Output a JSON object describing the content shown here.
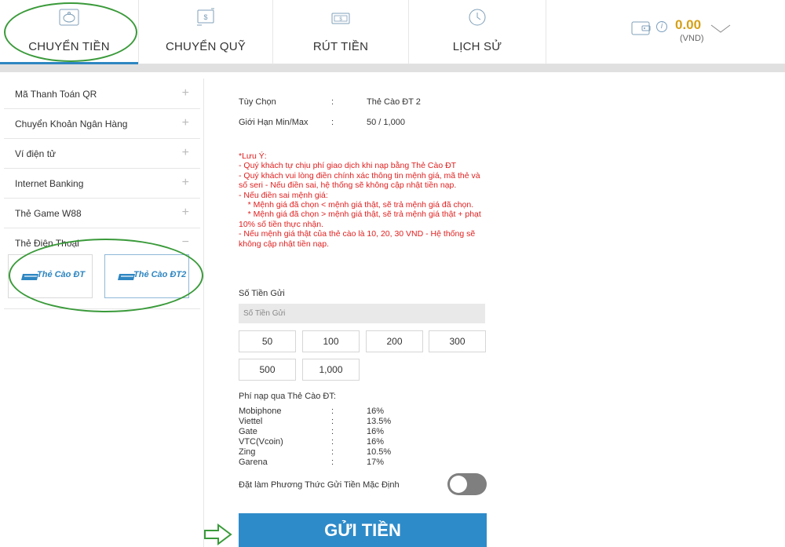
{
  "nav": {
    "tabs": [
      {
        "label": "CHUYỂN TIỀN",
        "icon": "piggy-bank-icon",
        "active": true
      },
      {
        "label": "CHUYỂN QUỸ",
        "icon": "transfer-icon",
        "active": false
      },
      {
        "label": "RÚT TIỀN",
        "icon": "cash-icon",
        "active": false
      },
      {
        "label": "LỊCH SỬ",
        "icon": "history-icon",
        "active": false
      }
    ],
    "info": "i",
    "balance": "0.00",
    "currency": "(VND)"
  },
  "sidebar": {
    "items": [
      {
        "label": "Mã Thanh Toán QR",
        "toggle": "+"
      },
      {
        "label": "Chuyển Khoản Ngân Hàng",
        "toggle": "+"
      },
      {
        "label": "Ví điện tử",
        "toggle": "+"
      },
      {
        "label": "Internet Banking",
        "toggle": "+"
      },
      {
        "label": "Thẻ Game W88",
        "toggle": "+"
      },
      {
        "label": "Thẻ Điện Thoại",
        "toggle": "−"
      }
    ],
    "cards": [
      {
        "label": "Thẻ Cào ĐT",
        "selected": false
      },
      {
        "label": "Thẻ Cào ĐT2",
        "selected": true
      }
    ]
  },
  "form": {
    "option_label": "Tùy Chọn",
    "option_sep": ":",
    "option_value": "Thẻ Cào ĐT 2",
    "limit_label": "Giới Hạn Min/Max",
    "limit_sep": ":",
    "limit_value": "50 / 1,000",
    "notice": "*Lưu Ý:\n- Quý khách tự chịu phí giao dịch khi nạp bằng Thẻ Cào ĐT\n- Quý khách vui lòng điền chính xác thông tin mệnh giá, mã thẻ và số seri - Nếu điền sai, hệ thống sẽ không cập nhật tiền nạp.\n- Nếu điền sai mệnh giá:\n    * Mệnh giá đã chọn < mệnh giá thật, sẽ trả mệnh giá đã chọn.\n    * Mệnh giá đã chọn > mệnh giá thật, sẽ trả mệnh giá thật + phạt 10% số tiền thực nhận.\n- Nếu mệnh giá thật của thẻ cào là 10, 20, 30 VND - Hệ thống sẽ không cập nhật tiền nạp.",
    "amount_label": "Số Tiền Gửi",
    "amount_placeholder": "Số Tiền Gửi",
    "amount_value": "",
    "presets": [
      "50",
      "100",
      "200",
      "300",
      "500",
      "1,000"
    ],
    "fee_title": "Phí nạp qua Thẻ Cào ĐT:",
    "fees": [
      {
        "name": "Mobiphone",
        "sep": ":",
        "rate": "16%"
      },
      {
        "name": "Viettel",
        "sep": ":",
        "rate": "13.5%"
      },
      {
        "name": "Gate",
        "sep": ":",
        "rate": "16%"
      },
      {
        "name": "VTC(Vcoin)",
        "sep": ":",
        "rate": "16%"
      },
      {
        "name": "Zing",
        "sep": ":",
        "rate": "10.5%"
      },
      {
        "name": "Garena",
        "sep": ":",
        "rate": "17%"
      }
    ],
    "default_label": "Đặt làm Phương Thức Gửi Tiền Mặc Định",
    "default_on": false,
    "submit_label": "GỬI TIỀN"
  },
  "colors": {
    "accent": "#2e8bc9",
    "balance": "#d4a017",
    "notice": "#e02020",
    "annotation": "#3a9a3a"
  }
}
